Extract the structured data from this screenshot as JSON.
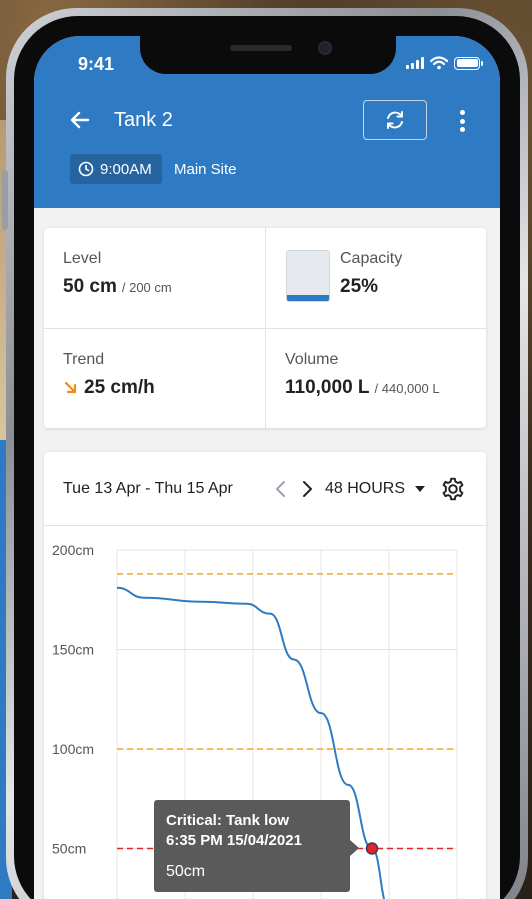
{
  "status_bar": {
    "time": "9:41"
  },
  "header": {
    "title": "Tank 2",
    "time_chip": "9:00AM",
    "site": "Main Site"
  },
  "stats": {
    "level": {
      "label": "Level",
      "value": "50 cm",
      "max": "/ 200 cm"
    },
    "capacity": {
      "label": "Capacity",
      "value": "25%",
      "fill_fraction": 0.25
    },
    "trend": {
      "label": "Trend",
      "value": "25 cm/h",
      "direction": "down"
    },
    "volume": {
      "label": "Volume",
      "value": "110,000 L",
      "max": "/ 440,000 L"
    }
  },
  "chart_controls": {
    "date_range": "Tue 13 Apr - Thu 15 Apr",
    "hours": "48 HOURS"
  },
  "tooltip": {
    "line1": "Critical: Tank low",
    "line2": "6:35 PM 15/04/2021",
    "value": "50cm"
  },
  "colors": {
    "brand": "#2e7bc4",
    "warning": "#f5a623",
    "critical": "#e0262b",
    "trend_arrow": "#f08c1e"
  },
  "chart_data": {
    "type": "line",
    "ylim": [
      0,
      200
    ],
    "y_ticks": [
      "200cm",
      "150cm",
      "100cm",
      "50cm"
    ],
    "y_tick_values": [
      200,
      150,
      100,
      50
    ],
    "thresholds": [
      {
        "value": 188,
        "kind": "warning"
      },
      {
        "value": 100,
        "kind": "warning"
      },
      {
        "value": 50,
        "kind": "critical"
      }
    ],
    "x": [
      0,
      0.08,
      0.25,
      0.38,
      0.45,
      0.52,
      0.6,
      0.68,
      0.75,
      0.8
    ],
    "xlim": [
      0,
      1
    ],
    "x_grid_count": 6,
    "series": [
      {
        "values": [
          181,
          176,
          174,
          173,
          168,
          145,
          118,
          82,
          50,
          20
        ]
      }
    ],
    "highlight_point": {
      "x": 0.75,
      "y": 50
    },
    "grid": true
  }
}
